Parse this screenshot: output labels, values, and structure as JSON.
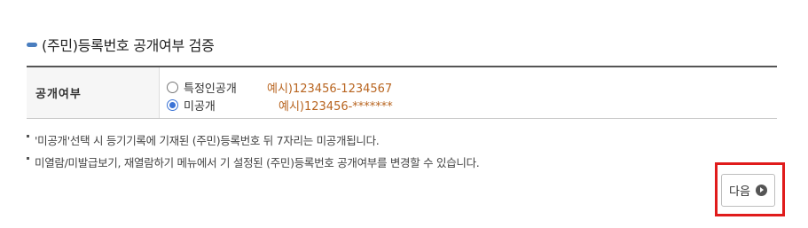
{
  "section": {
    "title": "(주민)등록번호 공개여부 검증",
    "accent_color": "#4a7ebf"
  },
  "form": {
    "field_label": "공개여부",
    "options": [
      {
        "label": "특정인공개",
        "example": "예시)123456-1234567",
        "selected": false
      },
      {
        "label": "미공개",
        "example": "예시)123456-*******",
        "selected": true
      }
    ],
    "example_color": "#b8641f"
  },
  "notes": [
    "'미공개'선택 시 등기기록에 기재된 (주민)등록번호 뒤 7자리는 미공개됩니다.",
    "미열람/미발급보기, 재열람하기 메뉴에서 기 설정된 (주민)등록번호 공개여부를 변경할 수 있습니다."
  ],
  "actions": {
    "next_label": "다음",
    "next_icon": "play-circle-icon",
    "highlight_color": "#e01b1b"
  }
}
